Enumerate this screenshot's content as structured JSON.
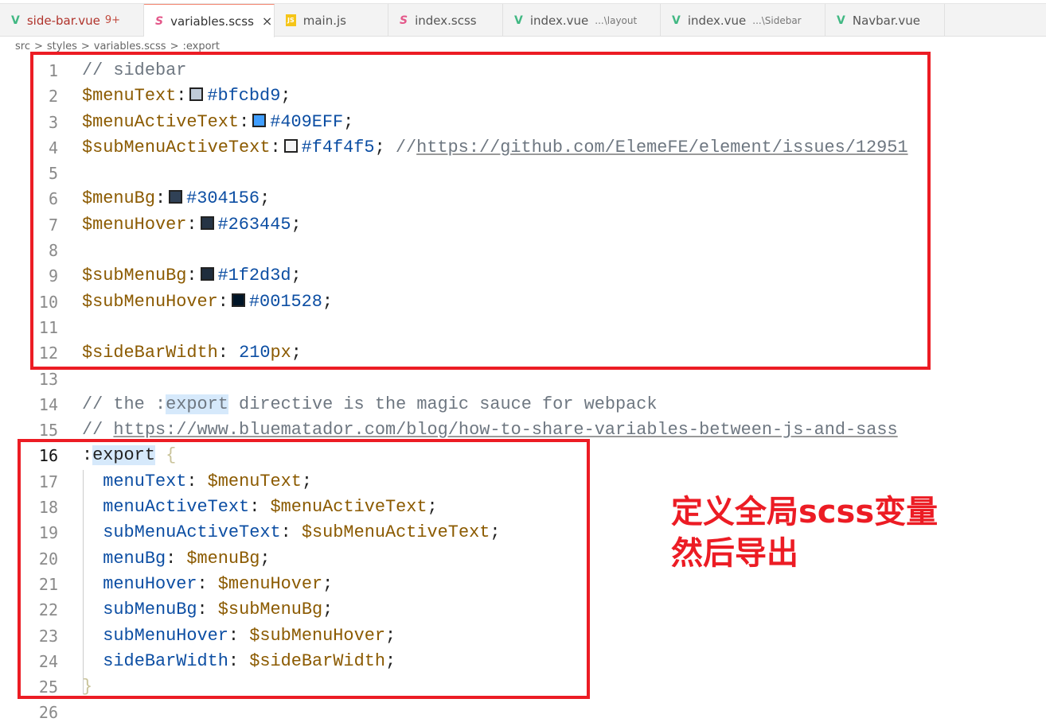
{
  "tabs": [
    {
      "icon": "vue",
      "label": "side-bar.vue",
      "badge": "9+",
      "error": true
    },
    {
      "icon": "sass",
      "label": "variables.scss",
      "active": true,
      "close": "×"
    },
    {
      "icon": "js",
      "label": "main.js"
    },
    {
      "icon": "sass",
      "label": "index.scss"
    },
    {
      "icon": "vue",
      "label": "index.vue",
      "sub": "...\\layout"
    },
    {
      "icon": "vue",
      "label": "index.vue",
      "sub": "...\\Sidebar"
    },
    {
      "icon": "vue",
      "label": "Navbar.vue"
    }
  ],
  "breadcrumb": [
    "src",
    ">",
    "styles",
    ">",
    "variables.scss",
    ">",
    ":export"
  ],
  "current_line": 16,
  "lines": [
    [
      [
        "cm",
        "// sidebar"
      ]
    ],
    [
      [
        "var",
        "$menuText"
      ],
      [
        "p",
        ":"
      ],
      [
        "sw",
        "#bfcbd9"
      ],
      [
        "val",
        "#bfcbd9"
      ],
      [
        "p",
        ";"
      ]
    ],
    [
      [
        "var",
        "$menuActiveText"
      ],
      [
        "p",
        ":"
      ],
      [
        "sw",
        "#409EFF"
      ],
      [
        "val",
        "#409EFF"
      ],
      [
        "p",
        ";"
      ]
    ],
    [
      [
        "var",
        "$subMenuActiveText"
      ],
      [
        "p",
        ":"
      ],
      [
        "sw",
        "#f4f4f5"
      ],
      [
        "val",
        "#f4f4f5"
      ],
      [
        "p",
        "; "
      ],
      [
        "cm",
        "//"
      ],
      [
        "lnk",
        "https://github.com/ElemeFE/element/issues/12951"
      ]
    ],
    [],
    [
      [
        "var",
        "$menuBg"
      ],
      [
        "p",
        ":"
      ],
      [
        "sw",
        "#304156"
      ],
      [
        "val",
        "#304156"
      ],
      [
        "p",
        ";"
      ]
    ],
    [
      [
        "var",
        "$menuHover"
      ],
      [
        "p",
        ":"
      ],
      [
        "sw",
        "#263445"
      ],
      [
        "val",
        "#263445"
      ],
      [
        "p",
        ";"
      ]
    ],
    [],
    [
      [
        "var",
        "$subMenuBg"
      ],
      [
        "p",
        ":"
      ],
      [
        "sw",
        "#1f2d3d"
      ],
      [
        "val",
        "#1f2d3d"
      ],
      [
        "p",
        ";"
      ]
    ],
    [
      [
        "var",
        "$subMenuHover"
      ],
      [
        "p",
        ":"
      ],
      [
        "sw",
        "#001528"
      ],
      [
        "val",
        "#001528"
      ],
      [
        "p",
        ";"
      ]
    ],
    [],
    [
      [
        "var",
        "$sideBarWidth"
      ],
      [
        "p",
        ": "
      ],
      [
        "val",
        "210"
      ],
      [
        "unit",
        "px"
      ],
      [
        "p",
        ";"
      ]
    ],
    [],
    [
      [
        "cm",
        "// the :"
      ],
      [
        "cmhl",
        "export"
      ],
      [
        "cm",
        " directive is the magic sauce for webpack"
      ]
    ],
    [
      [
        "cm",
        "// "
      ],
      [
        "lnk",
        "https://www.bluematador.com/blog/how-to-share-variables-between-js-and-sass"
      ]
    ],
    [
      [
        "sel",
        ":"
      ],
      [
        "selhl",
        "export"
      ],
      [
        "p",
        " "
      ],
      [
        "br",
        "{"
      ]
    ],
    [
      [
        "p",
        "  "
      ],
      [
        "prop",
        "menuText"
      ],
      [
        "p",
        ": "
      ],
      [
        "var",
        "$menuText"
      ],
      [
        "p",
        ";"
      ]
    ],
    [
      [
        "p",
        "  "
      ],
      [
        "prop",
        "menuActiveText"
      ],
      [
        "p",
        ": "
      ],
      [
        "var",
        "$menuActiveText"
      ],
      [
        "p",
        ";"
      ]
    ],
    [
      [
        "p",
        "  "
      ],
      [
        "prop",
        "subMenuActiveText"
      ],
      [
        "p",
        ": "
      ],
      [
        "var",
        "$subMenuActiveText"
      ],
      [
        "p",
        ";"
      ]
    ],
    [
      [
        "p",
        "  "
      ],
      [
        "prop",
        "menuBg"
      ],
      [
        "p",
        ": "
      ],
      [
        "var",
        "$menuBg"
      ],
      [
        "p",
        ";"
      ]
    ],
    [
      [
        "p",
        "  "
      ],
      [
        "prop",
        "menuHover"
      ],
      [
        "p",
        ": "
      ],
      [
        "var",
        "$menuHover"
      ],
      [
        "p",
        ";"
      ]
    ],
    [
      [
        "p",
        "  "
      ],
      [
        "prop",
        "subMenuBg"
      ],
      [
        "p",
        ": "
      ],
      [
        "var",
        "$subMenuBg"
      ],
      [
        "p",
        ";"
      ]
    ],
    [
      [
        "p",
        "  "
      ],
      [
        "prop",
        "subMenuHover"
      ],
      [
        "p",
        ": "
      ],
      [
        "var",
        "$subMenuHover"
      ],
      [
        "p",
        ";"
      ]
    ],
    [
      [
        "p",
        "  "
      ],
      [
        "prop",
        "sideBarWidth"
      ],
      [
        "p",
        ": "
      ],
      [
        "var",
        "$sideBarWidth"
      ],
      [
        "p",
        ";"
      ]
    ],
    [
      [
        "br",
        "}"
      ]
    ],
    []
  ],
  "annotation": {
    "line1": "定义全局scss变量",
    "line2": "然后导出"
  }
}
